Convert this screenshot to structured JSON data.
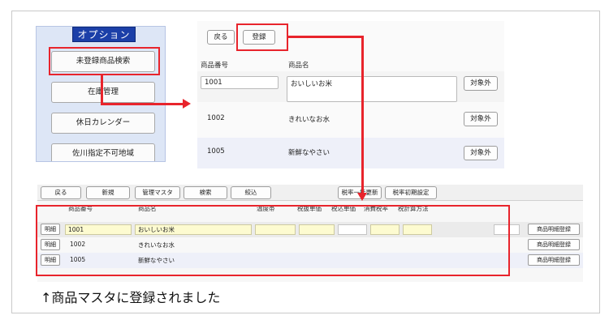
{
  "options": {
    "title": "オプション",
    "buttons": [
      "未登録商品検索",
      "在庫管理",
      "休日カレンダー",
      "佐川指定不可地域"
    ]
  },
  "top_form": {
    "back_label": "戻る",
    "register_label": "登録",
    "col_code": "商品番号",
    "col_name": "商品名",
    "rows": [
      {
        "code": "1001",
        "name": "おいしいお米",
        "action": "対象外"
      },
      {
        "code": "1002",
        "name": "きれいなお水",
        "action": "対象外"
      },
      {
        "code": "1005",
        "name": "新鮮なやさい",
        "action": "対象外"
      }
    ]
  },
  "toolbar": {
    "buttons": [
      "戻る",
      "新規",
      "管理マスタ",
      "検索",
      "絞込",
      "税率一括更新",
      "税率初期設定"
    ]
  },
  "grid": {
    "headers": [
      "商品番号",
      "商品名",
      "温度帯",
      "税抜単価",
      "税込単価",
      "消費税率",
      "税計算方法"
    ],
    "detail_label": "明細",
    "register_detail_label": "商品明細登録",
    "rows": [
      {
        "code": "1001",
        "name": "おいしいお米"
      },
      {
        "code": "1002",
        "name": "きれいなお水"
      },
      {
        "code": "1005",
        "name": "新鮮なやさい"
      }
    ]
  },
  "caption": "↑商品マスタに登録されました",
  "colors": {
    "highlight": "#e8242c",
    "title_bar": "#1b3fa8"
  }
}
